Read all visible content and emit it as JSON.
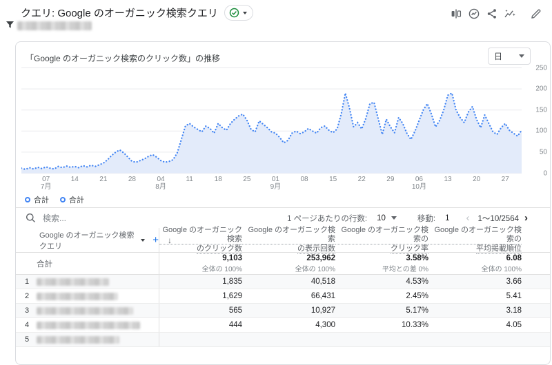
{
  "header": {
    "title": "クエリ: Google のオーガニック検索クエリ",
    "badge": "valid-check",
    "toolbar_icons": [
      "comparison-icon",
      "insights-icon",
      "share-icon",
      "explore-icon",
      "edit-icon"
    ],
    "filter_chip_redacted": true
  },
  "chart_data": {
    "type": "line",
    "style": "dotted-area",
    "title": "「Google のオーガニック検索のクリック数」の推移",
    "interval": "日",
    "ylabel": "",
    "ylim": [
      0,
      250
    ],
    "yticks": [
      0,
      50,
      100,
      150,
      200,
      250
    ],
    "grid": true,
    "legend": [
      "合計",
      "合計"
    ],
    "legend_position": "bottom-left",
    "line_color": "#4285f4",
    "fill_color": "#e3ebfa",
    "xticks": [
      {
        "label": "07",
        "month": "7月",
        "index": 6
      },
      {
        "label": "14",
        "index": 13
      },
      {
        "label": "21",
        "index": 20
      },
      {
        "label": "28",
        "index": 27
      },
      {
        "label": "04",
        "month": "8月",
        "index": 34
      },
      {
        "label": "11",
        "index": 41
      },
      {
        "label": "18",
        "index": 48
      },
      {
        "label": "25",
        "index": 55
      },
      {
        "label": "01",
        "month": "9月",
        "index": 62
      },
      {
        "label": "08",
        "index": 69
      },
      {
        "label": "15",
        "index": 76
      },
      {
        "label": "22",
        "index": 83
      },
      {
        "label": "29",
        "index": 90
      },
      {
        "label": "06",
        "month": "10月",
        "index": 97
      },
      {
        "label": "13",
        "index": 104
      },
      {
        "label": "20",
        "index": 111
      },
      {
        "label": "27",
        "index": 118
      }
    ],
    "values": [
      12,
      9,
      13,
      10,
      14,
      11,
      15,
      12,
      10,
      16,
      13,
      17,
      14,
      16,
      13,
      18,
      15,
      19,
      16,
      20,
      24,
      32,
      42,
      50,
      55,
      48,
      38,
      28,
      26,
      30,
      34,
      40,
      44,
      38,
      30,
      26,
      28,
      32,
      48,
      80,
      112,
      118,
      110,
      104,
      98,
      112,
      106,
      95,
      118,
      108,
      102,
      118,
      128,
      136,
      140,
      126,
      104,
      98,
      124,
      116,
      108,
      98,
      95,
      85,
      72,
      78,
      95,
      100,
      94,
      98,
      106,
      100,
      95,
      108,
      112,
      102,
      96,
      105,
      140,
      190,
      155,
      110,
      120,
      105,
      130,
      165,
      168,
      130,
      92,
      128,
      110,
      96,
      132,
      118,
      95,
      80,
      100,
      125,
      150,
      165,
      140,
      110,
      125,
      150,
      185,
      190,
      150,
      132,
      120,
      145,
      158,
      128,
      108,
      138,
      118,
      98,
      92,
      108,
      118,
      102,
      95,
      88,
      102
    ]
  },
  "table_controls": {
    "search_placeholder": "検索...",
    "rows_per_page_label": "1 ページあたりの行数:",
    "rows_per_page": "10",
    "goto_label": "移動:",
    "goto_value": "1",
    "range": "1～10/2564",
    "prev_icon": "chevron-left",
    "next_icon": "chevron-right"
  },
  "table": {
    "dimension_header": "Google のオーガニック検索クエリ",
    "metric_headers": [
      {
        "line1": "Google のオーガニック検索",
        "line2": "のクリック数",
        "sorted": true
      },
      {
        "line1": "Google のオーガニック検索",
        "line2": "の表示回数",
        "sorted": false
      },
      {
        "line1": "Google のオーガニック検索の",
        "line2": "クリック率",
        "sorted": false
      },
      {
        "line1": "Google のオーガニック検索の",
        "line2": "平均掲載順位",
        "sorted": false
      }
    ],
    "totals": {
      "label": "合計",
      "values": [
        {
          "v": "9,103",
          "sub": "全体の 100%"
        },
        {
          "v": "253,962",
          "sub": "全体の 100%"
        },
        {
          "v": "3.58%",
          "sub": "平均との差 0%"
        },
        {
          "v": "6.08",
          "sub": "全体の 100%"
        }
      ]
    },
    "rows": [
      {
        "n": "1",
        "query_redacted": true,
        "blur_width": 105,
        "values": [
          "1,835",
          "40,518",
          "4.53%",
          "3.66"
        ]
      },
      {
        "n": "2",
        "query_redacted": true,
        "blur_width": 118,
        "values": [
          "1,629",
          "66,431",
          "2.45%",
          "5.41"
        ]
      },
      {
        "n": "3",
        "query_redacted": true,
        "blur_width": 140,
        "values": [
          "565",
          "10,927",
          "5.17%",
          "3.18"
        ]
      },
      {
        "n": "4",
        "query_redacted": true,
        "blur_width": 150,
        "values": [
          "444",
          "4,300",
          "10.33%",
          "4.05"
        ]
      },
      {
        "n": "5",
        "query_redacted": true,
        "blur_width": 120,
        "partial": true,
        "values": [
          "",
          "",
          "",
          ""
        ]
      }
    ]
  }
}
